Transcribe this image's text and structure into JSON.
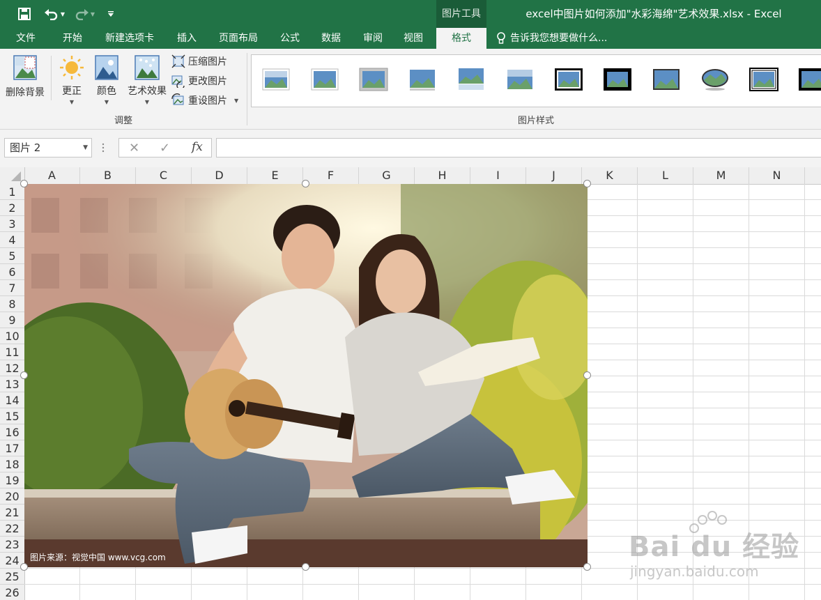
{
  "window": {
    "title": "excel中图片如何添加\"水彩海绵\"艺术效果.xlsx - Excel"
  },
  "qat": {
    "save": "save-icon",
    "undo": "undo-icon",
    "redo": "redo-icon",
    "customize": "customize-icon"
  },
  "context_tab_group": "图片工具",
  "tabs": [
    {
      "label": "文件"
    },
    {
      "label": "开始"
    },
    {
      "label": "新建选项卡"
    },
    {
      "label": "插入"
    },
    {
      "label": "页面布局"
    },
    {
      "label": "公式"
    },
    {
      "label": "数据"
    },
    {
      "label": "审阅"
    },
    {
      "label": "视图"
    },
    {
      "label": "格式",
      "active": true
    }
  ],
  "tell_me": "告诉我您想要做什么...",
  "ribbon": {
    "remove_background": "删除背景",
    "corrections": "更正",
    "color": "颜色",
    "artistic_effects": "艺术效果",
    "compress": "压缩图片",
    "change": "更改图片",
    "reset": "重设图片",
    "adjust_group": "调整",
    "styles_group": "图片样式"
  },
  "formula_bar": {
    "name_box": "图片 2",
    "cancel": "✕",
    "enter": "✓",
    "fx": "fx",
    "formula": ""
  },
  "columns": [
    "A",
    "B",
    "C",
    "D",
    "E",
    "F",
    "G",
    "H",
    "I",
    "J",
    "K",
    "L",
    "M",
    "N"
  ],
  "rows": [
    "1",
    "2",
    "3",
    "4",
    "5",
    "6",
    "7",
    "8",
    "9",
    "10",
    "11",
    "12",
    "13",
    "14",
    "15",
    "16",
    "17",
    "18",
    "19",
    "20",
    "21",
    "22",
    "23",
    "24",
    "25",
    "26"
  ],
  "picture": {
    "credit": "图片来源：视觉中国 www.vcg.com"
  },
  "watermark": {
    "brand": "Bai du 经验",
    "url": "jingyan.baidu.com"
  },
  "colors": {
    "excel_green": "#217346",
    "ribbon_bg": "#f3f3f3",
    "grid": "#dadada"
  }
}
